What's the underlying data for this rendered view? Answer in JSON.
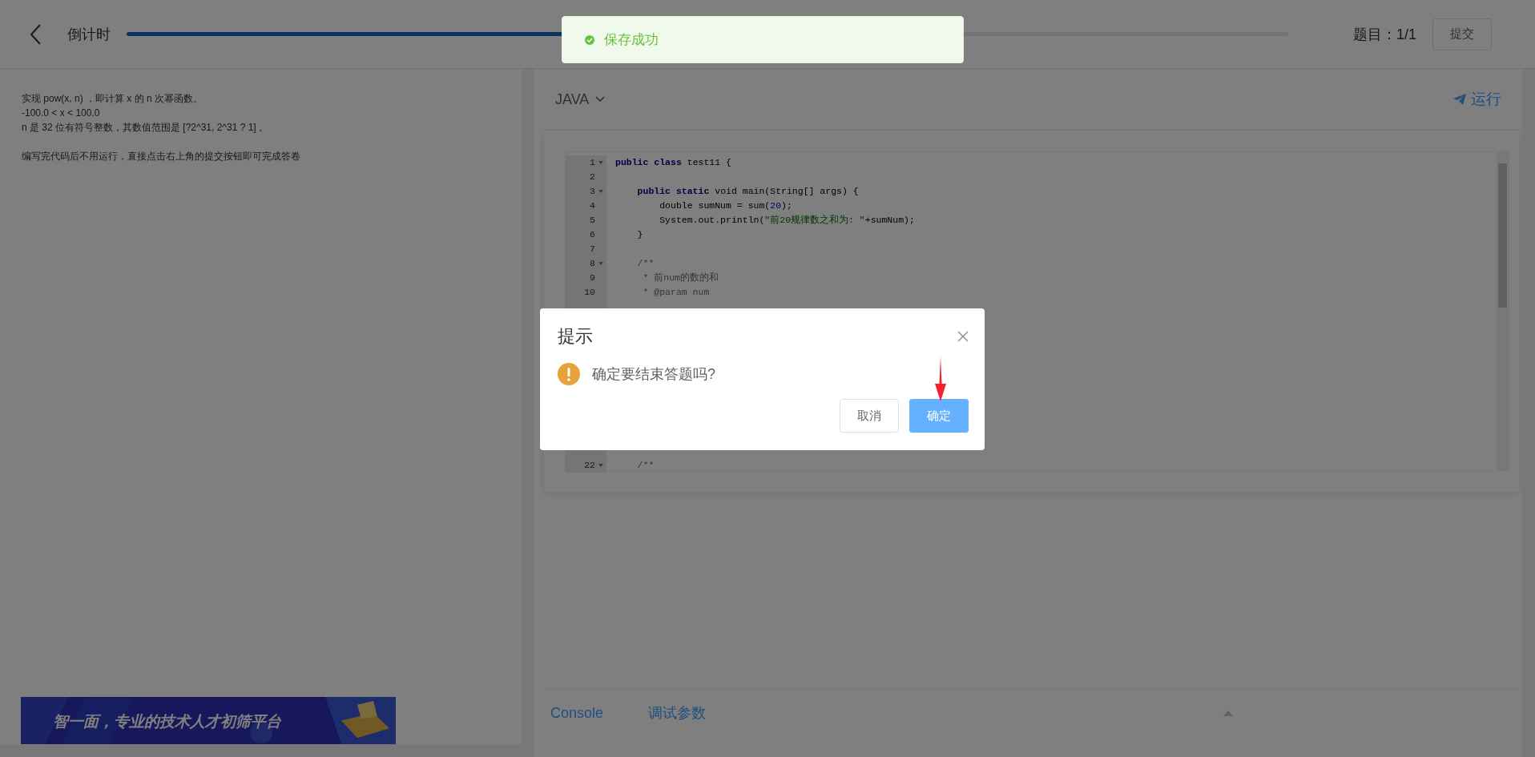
{
  "header": {
    "title": "倒计时",
    "timer": {
      "level": 0.42
    },
    "question_counter": "题目：1/1",
    "submit_button": "提交"
  },
  "toast": {
    "kind": "success",
    "message": "保存成功"
  },
  "problem": {
    "paragraphs": [
      "实现 pow(x, n) ，即计算 x 的 n 次幂函数。",
      "-100.0 < x < 100.0",
      "n 是 32 位有符号整数，其数值范围是 [?2^31, 2^31 ? 1] 。",
      "编写完代码后不用运行，直接点击右上角的提交按钮即可完成答卷"
    ],
    "banner": "智一面，专业的技术人才初筛平台"
  },
  "editor": {
    "language": "JAVA",
    "run_button": "运行",
    "lines": [
      {
        "number": "1",
        "fold": true,
        "tokens": [
          {
            "kind": "keyword",
            "text": "public class"
          },
          {
            "kind": "plain",
            "text": " test11 {"
          }
        ]
      },
      {
        "number": "2",
        "fold": false
      },
      {
        "number": "3",
        "fold": true,
        "tokens": [
          {
            "kind": "keyword",
            "text": "    public static"
          },
          {
            "kind": "plain",
            "text": " void main(String[] args) {"
          }
        ]
      },
      {
        "number": "4",
        "fold": false,
        "tokens": [
          {
            "kind": "plain",
            "text": "        double sumNum = sum("
          },
          {
            "kind": "number",
            "text": "20"
          },
          {
            "kind": "plain",
            "text": ");"
          }
        ]
      },
      {
        "number": "5",
        "fold": false,
        "tokens": [
          {
            "kind": "plain",
            "text": "        System.out.println("
          },
          {
            "kind": "string",
            "text": "\"前20规律数之和为: \""
          },
          {
            "kind": "plain",
            "text": "+sumNum);"
          }
        ]
      },
      {
        "number": "6",
        "fold": false,
        "tokens": [
          {
            "kind": "plain",
            "text": "    }"
          }
        ]
      },
      {
        "number": "7",
        "fold": false
      },
      {
        "number": "8",
        "fold": true,
        "tokens": [
          {
            "kind": "comment",
            "text": "    /**"
          }
        ]
      },
      {
        "number": "9",
        "fold": false,
        "tokens": [
          {
            "kind": "comment",
            "text": "     * 前num的数的和"
          }
        ]
      },
      {
        "number": "10",
        "fold": false,
        "tokens": [
          {
            "kind": "comment",
            "text": "     * @param num"
          }
        ]
      }
    ],
    "lines_after_dialog": [
      {
        "number": "22",
        "fold": true,
        "tokens": [
          {
            "kind": "comment",
            "text": "    /**"
          }
        ]
      }
    ]
  },
  "console": {
    "tabs": [
      "Console",
      "调试参数"
    ]
  },
  "dialog": {
    "title": "提示",
    "message": "确定要结束答题吗?",
    "buttons": [
      {
        "label": "取消",
        "primary": false
      },
      {
        "label": "确定",
        "primary": true
      }
    ]
  }
}
